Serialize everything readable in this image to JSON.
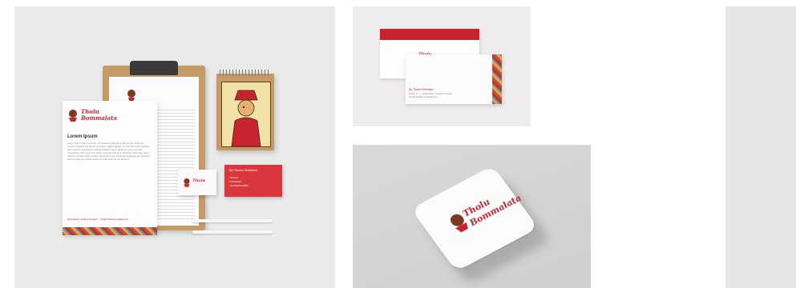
{
  "brand": {
    "logo_line1": "Tholu",
    "logo_line2": "Bommalata",
    "accent_color": "#c8242f",
    "kraft_color": "#c49a67"
  },
  "letterhead": {
    "heading": "Lorem Ipsum",
    "body": "Lorem ipsum dolor sit amet, consectetur adipiscing elit, sed do eiusmod tempor incididunt ut labore et dolore magna aliqua. Ut enim ad minim veniam, quis nostrud exercitation ullamco laboris nisi ut aliquip ex ea commodo consequat. Duis aute irure dolor in reprehenderit in voluptate velit esse cillum dolore eu fugiat nulla pariatur. Excepteur sint occaecat cupidatat non proident, sunt in culpa qui officia deserunt mollit anim id est laborum.",
    "footer": "Hyderabad, Andhra Pradesh · info@tholubommalata.com"
  },
  "business_card": {
    "name": "By Thanvi Shrimant",
    "lines": [
      "Founder",
      "Hyderabad",
      "+91 00000 00000"
    ]
  },
  "envelope": {
    "sender": "By Thanvi Shrimant",
    "address": "Road no. 1, Hyderabad, Andhra Pradesh",
    "contact": "info@tholubommalata.com"
  },
  "panels": {
    "main": "stationery-mockup",
    "envelope": "envelope-mockup",
    "coaster": "coaster-mockup",
    "right": "partial-mockup"
  }
}
